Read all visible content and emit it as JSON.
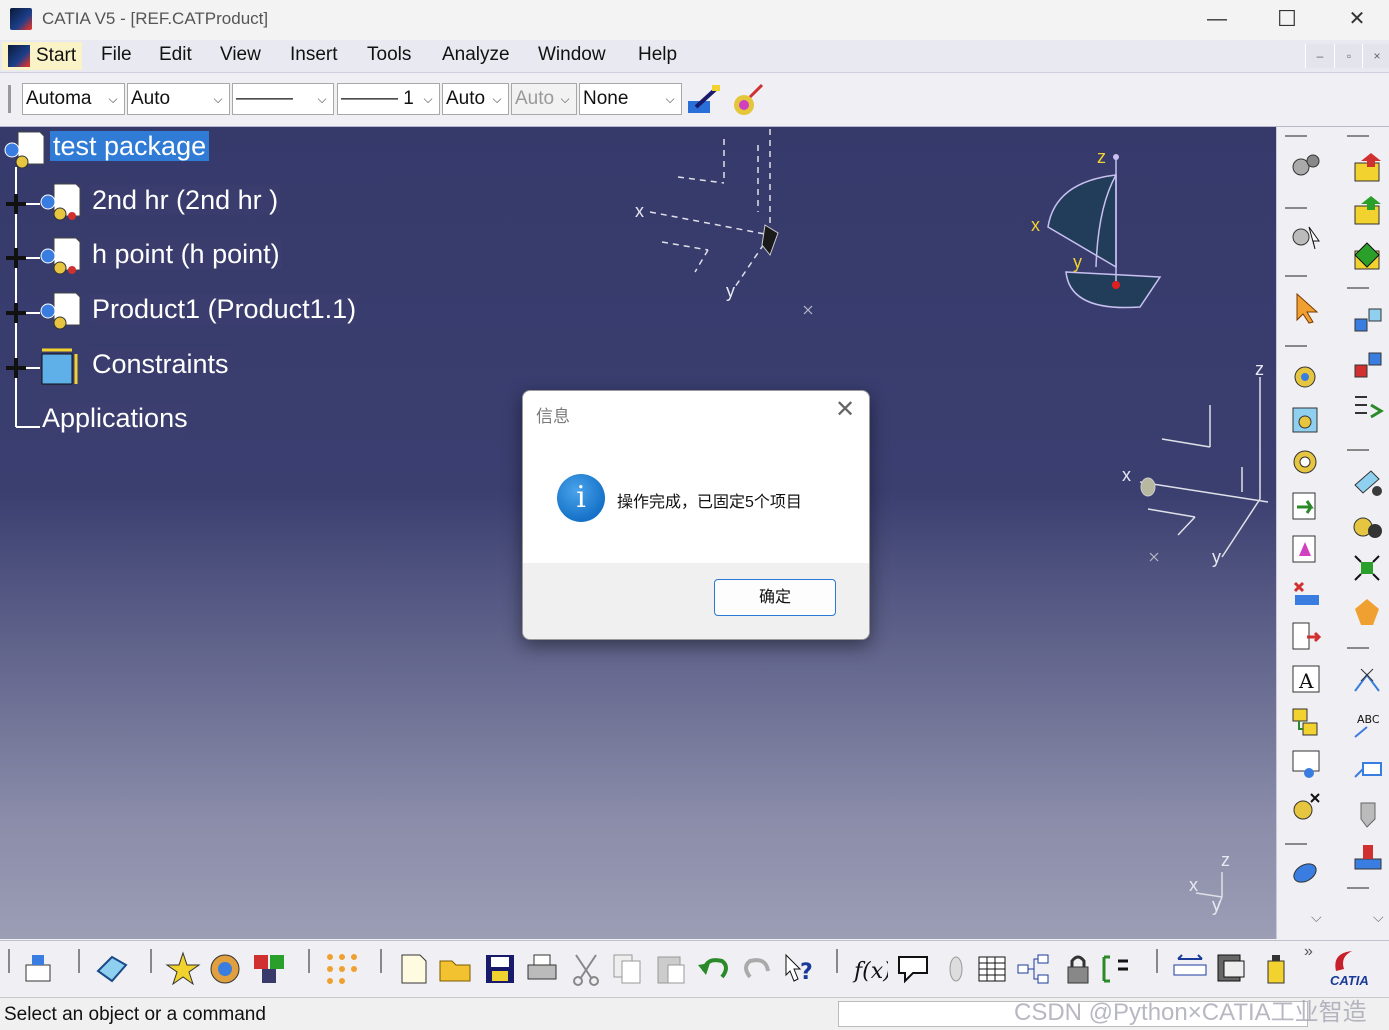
{
  "window": {
    "title": "CATIA V5 - [REF.CATProduct]",
    "minimize_glyph": "—",
    "maximize_glyph": "☐",
    "close_glyph": "✕"
  },
  "menu": {
    "start": "Start",
    "items": [
      "File",
      "Edit",
      "View",
      "Insert",
      "Tools",
      "Analyze",
      "Window",
      "Help"
    ],
    "mdi_minimize": "–",
    "mdi_restore": "▫",
    "mdi_close": "×"
  },
  "toolbar": {
    "combos": [
      {
        "value": "Automa",
        "disabled": false
      },
      {
        "value": "Auto",
        "disabled": false
      },
      {
        "value": "———",
        "disabled": false
      },
      {
        "value": "——— 1",
        "disabled": false
      },
      {
        "value": "Auto",
        "disabled": false
      },
      {
        "value": "Auto",
        "disabled": true
      },
      {
        "value": "None",
        "disabled": false
      }
    ],
    "arrow_glyph": "⌵"
  },
  "tree": {
    "root": "test package",
    "children": [
      {
        "label": "2nd hr  (2nd hr )",
        "icon": "product-icon"
      },
      {
        "label": "h point (h point)",
        "icon": "product-icon"
      },
      {
        "label": "Product1 (Product1.1)",
        "icon": "product-icon"
      },
      {
        "label": "Constraints",
        "icon": "constraints-icon"
      },
      {
        "label": "Applications",
        "icon": ""
      }
    ]
  },
  "viewport": {
    "axis_labels": {
      "x": "x",
      "y": "y",
      "z": "z"
    }
  },
  "dialog": {
    "title": "信息",
    "close_glyph": "✕",
    "icon_glyph": "i",
    "message": "操作完成，已固定5个项目",
    "ok_label": "确定"
  },
  "status": {
    "text": "Select an object or a command",
    "watermark": "CSDN @Python×CATIA工业智造"
  },
  "colors": {
    "viewport_top": "#363a6b",
    "viewport_bottom": "#9c9eb6",
    "selection": "#2f7bd6",
    "dialog_button_border": "#2b78d6"
  }
}
